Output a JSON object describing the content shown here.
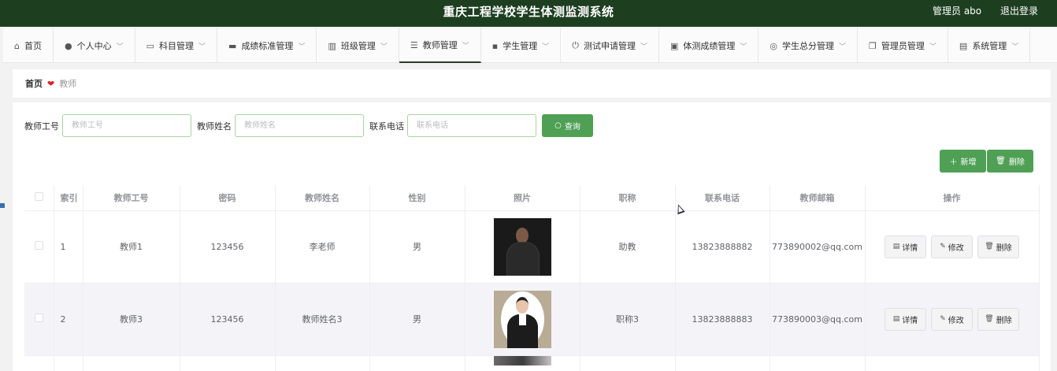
{
  "header": {
    "title": "重庆工程学校学生体测监测系统",
    "user": "管理员 abo",
    "logout": "退出登录"
  },
  "nav": [
    {
      "label": "首页",
      "icon": "home-icon"
    },
    {
      "label": "个人中心",
      "icon": "user-icon"
    },
    {
      "label": "科目管理",
      "icon": "subject-icon"
    },
    {
      "label": "成绩标准管理",
      "icon": "standard-icon"
    },
    {
      "label": "班级管理",
      "icon": "class-icon"
    },
    {
      "label": "教师管理",
      "icon": "list-icon"
    },
    {
      "label": "学生管理",
      "icon": "chat-icon"
    },
    {
      "label": "测试申请管理",
      "icon": "power-icon"
    },
    {
      "label": "体测成绩管理",
      "icon": "clipboard-icon"
    },
    {
      "label": "学生总分管理",
      "icon": "compass-icon"
    },
    {
      "label": "管理员管理",
      "icon": "copy-icon"
    },
    {
      "label": "系统管理",
      "icon": "system-icon"
    }
  ],
  "breadcrumb": {
    "home": "首页",
    "current": "教师"
  },
  "search": {
    "fields": [
      {
        "label": "教师工号",
        "placeholder": "教师工号"
      },
      {
        "label": "教师姓名",
        "placeholder": "教师姓名"
      },
      {
        "label": "联系电话",
        "placeholder": "联系电话"
      }
    ],
    "query_label": "查询"
  },
  "actions": {
    "add_label": "新增",
    "delete_label": "删除"
  },
  "table": {
    "columns": [
      "索引",
      "教师工号",
      "密码",
      "教师姓名",
      "性别",
      "照片",
      "职称",
      "联系电话",
      "教师邮箱",
      "操作"
    ],
    "rows": [
      {
        "index": "1",
        "id": "教师1",
        "password": "123456",
        "name": "李老师",
        "gender": "男",
        "title": "助教",
        "phone": "13823888882",
        "email": "773890002@qq.com"
      },
      {
        "index": "2",
        "id": "教师3",
        "password": "123456",
        "name": "教师姓名3",
        "gender": "男",
        "title": "职称3",
        "phone": "13823888883",
        "email": "773890003@qq.com"
      }
    ],
    "row_actions": {
      "detail": "详情",
      "edit": "修改",
      "delete": "删除"
    }
  }
}
